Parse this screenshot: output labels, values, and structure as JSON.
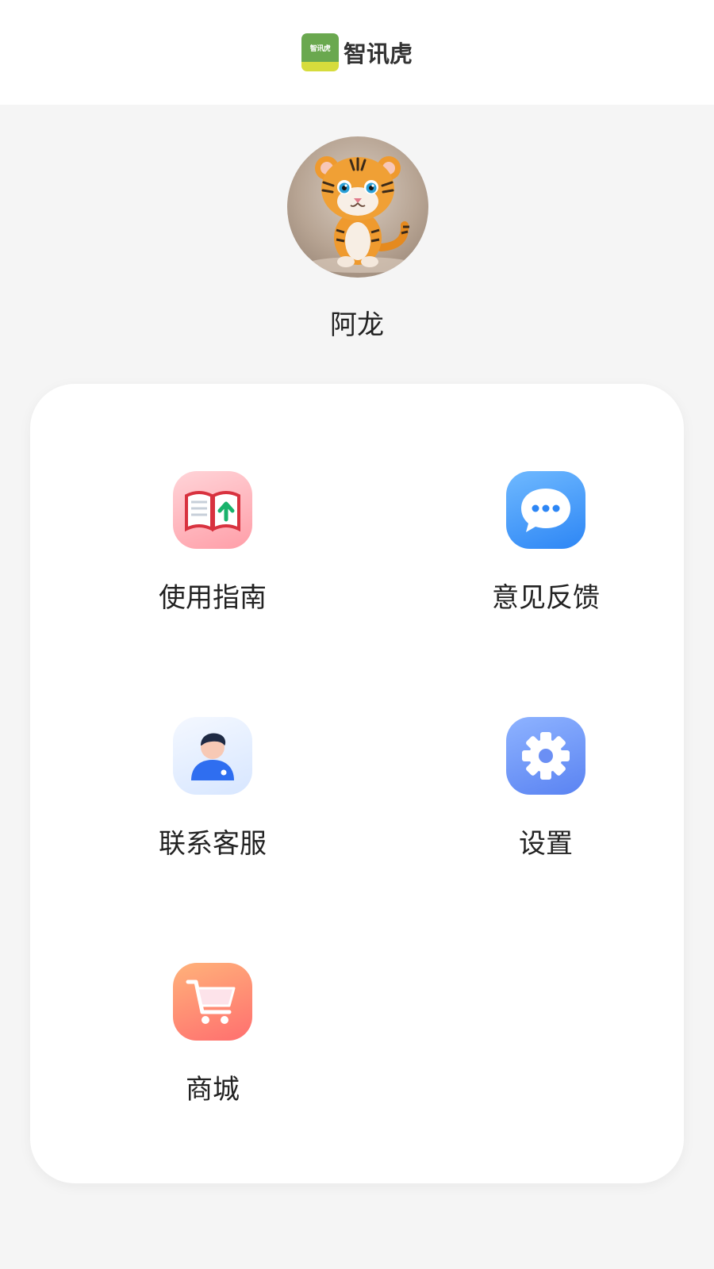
{
  "header": {
    "logo_text": "智讯虎",
    "app_name": "智讯虎"
  },
  "profile": {
    "username": "阿龙",
    "avatar_icon": "tiger-avatar"
  },
  "menu": {
    "items": [
      {
        "label": "使用指南",
        "icon": "book-icon"
      },
      {
        "label": "意见反馈",
        "icon": "chat-bubble-icon"
      },
      {
        "label": "联系客服",
        "icon": "user-service-icon"
      },
      {
        "label": "设置",
        "icon": "gear-icon"
      },
      {
        "label": "商城",
        "icon": "shopping-cart-icon"
      }
    ]
  }
}
